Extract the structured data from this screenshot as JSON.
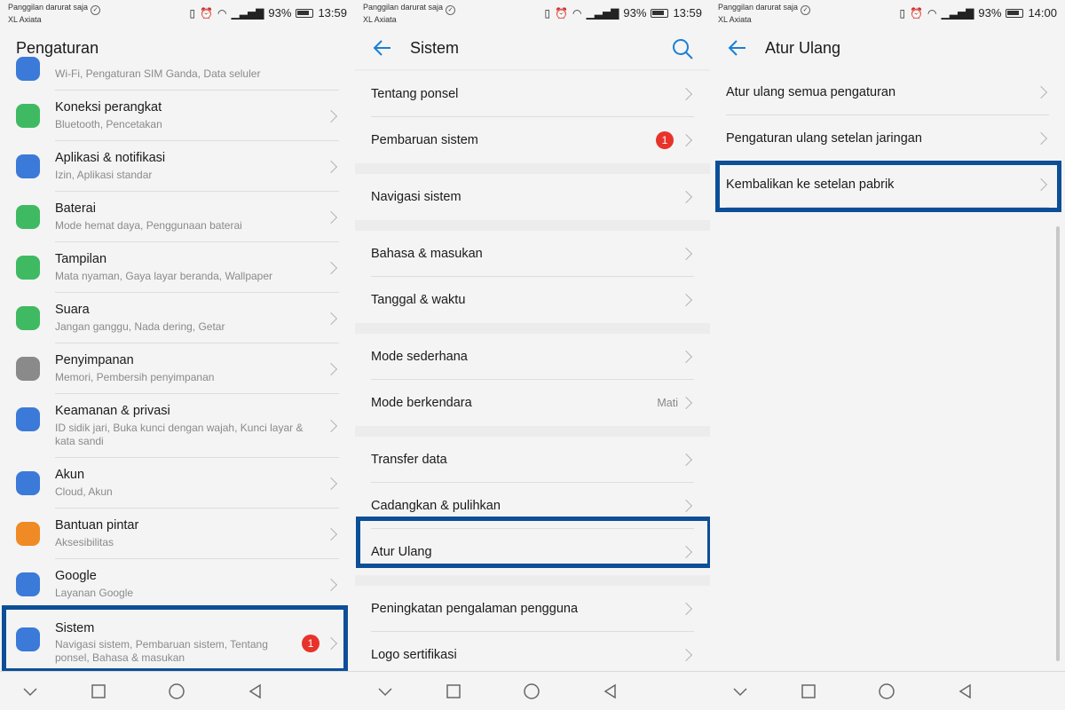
{
  "status": {
    "left_line1": "Panggilan darurat saja",
    "left_line2": "XL Axiata",
    "battery": "93%",
    "times": [
      "13:59",
      "13:59",
      "14:00"
    ]
  },
  "settings": {
    "title": "Pengaturan",
    "partial_item_sub": "Wi-Fi, Pengaturan SIM Ganda, Data seluler",
    "items": [
      {
        "name": "Koneksi perangkat",
        "sub": "Bluetooth, Pencetakan",
        "color": "#3fba62"
      },
      {
        "name": "Aplikasi & notifikasi",
        "sub": "Izin, Aplikasi standar",
        "color": "#3b7ad8"
      },
      {
        "name": "Baterai",
        "sub": "Mode hemat daya, Penggunaan baterai",
        "color": "#3fba62"
      },
      {
        "name": "Tampilan",
        "sub": "Mata nyaman, Gaya layar beranda, Wallpaper",
        "color": "#3fba62"
      },
      {
        "name": "Suara",
        "sub": "Jangan ganggu, Nada dering, Getar",
        "color": "#3fba62"
      },
      {
        "name": "Penyimpanan",
        "sub": "Memori, Pembersih penyimpanan",
        "color": "#8a8a8a"
      },
      {
        "name": "Keamanan & privasi",
        "sub": "ID sidik jari, Buka kunci dengan wajah, Kunci layar & kata sandi",
        "color": "#3b7ad8"
      },
      {
        "name": "Akun",
        "sub": "Cloud, Akun",
        "color": "#3b7ad8"
      },
      {
        "name": "Bantuan pintar",
        "sub": "Aksesibilitas",
        "color": "#f08a24"
      },
      {
        "name": "Google",
        "sub": "Layanan Google",
        "color": "#3b7ad8"
      },
      {
        "name": "Sistem",
        "sub": "Navigasi sistem, Pembaruan sistem, Tentang ponsel, Bahasa & masukan",
        "color": "#3b7ad8",
        "badge": "1"
      }
    ]
  },
  "system": {
    "title": "Sistem",
    "items": [
      {
        "label": "Tentang ponsel"
      },
      {
        "label": "Pembaruan sistem",
        "badge": "1"
      },
      {
        "label": "Navigasi sistem"
      },
      {
        "label": "Bahasa & masukan"
      },
      {
        "label": "Tanggal & waktu"
      },
      {
        "label": "Mode sederhana"
      },
      {
        "label": "Mode berkendara",
        "value": "Mati"
      },
      {
        "label": "Transfer data"
      },
      {
        "label": "Cadangkan & pulihkan"
      },
      {
        "label": "Atur Ulang"
      },
      {
        "label": "Peningkatan pengalaman pengguna"
      },
      {
        "label": "Logo sertifikasi"
      }
    ]
  },
  "reset": {
    "title": "Atur Ulang",
    "items": [
      {
        "label": "Atur ulang semua pengaturan"
      },
      {
        "label": "Pengaturan ulang setelan jaringan"
      },
      {
        "label": "Kembalikan ke setelan pabrik"
      }
    ]
  },
  "colors": {
    "accent": "#1a7fd4",
    "highlight": "#0d4f97",
    "badge": "#e8332a"
  }
}
